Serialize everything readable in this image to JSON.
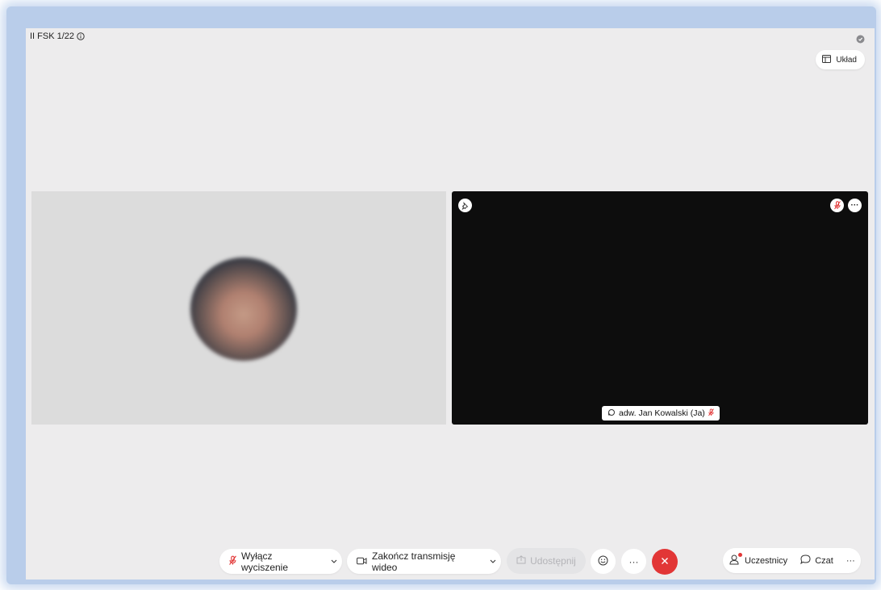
{
  "meeting": {
    "title": "II FSK 1/22"
  },
  "header": {
    "layout_label": "Układ"
  },
  "participants": {
    "self_name": "adw. Jan Kowalski (Ja)"
  },
  "toolbar": {
    "mute_label": "Wyłącz wyciszenie",
    "video_label": "Zakończ transmisję wideo",
    "share_label": "Udostępnij",
    "more_label": "···",
    "participants_label": "Uczestnicy",
    "chat_label": "Czat",
    "side_more_label": "···"
  },
  "colors": {
    "accent_red": "#e23636",
    "background": "#edeced",
    "video_bg": "#0d0d0d",
    "frame_blue": "#b9cdea"
  }
}
